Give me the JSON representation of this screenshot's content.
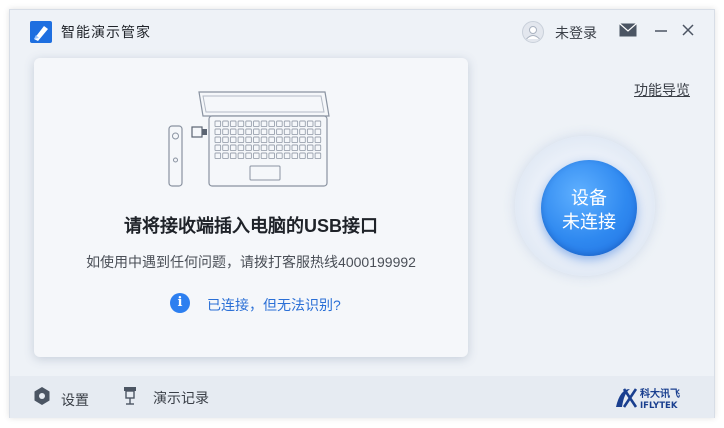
{
  "titlebar": {
    "app_title": "智能演示管家",
    "user_label": "未登录"
  },
  "main": {
    "heading": "请将接收端插入电脑的USB接口",
    "tip": "如使用中遇到任何问题，请拨打客服热线4000199992",
    "help_link": "已连接，但无法识别?",
    "guide_link": "功能导览"
  },
  "status": {
    "line1": "设备",
    "line2": "未连接"
  },
  "bottombar": {
    "settings_label": "设置",
    "record_label": "演示记录"
  },
  "brand": {
    "cn": "科大讯飞",
    "en": "IFLYTEK"
  },
  "colors": {
    "accent": "#2d7ff0",
    "link": "#2a6fd6",
    "window_bg": "#eef2f7",
    "card_bg": "#f5f7fa"
  }
}
